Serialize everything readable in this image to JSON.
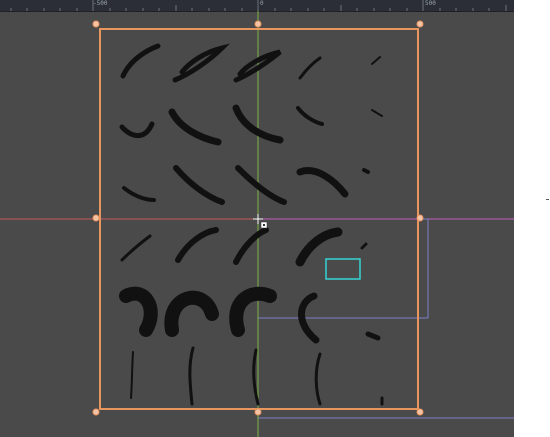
{
  "ruler": {
    "labels": [
      "-500",
      "0",
      "500"
    ]
  },
  "colors": {
    "viewport_bg": "#4a4a4a",
    "ruler_bg": "#2b2e36",
    "selection_rect": "#e8955e",
    "handle_fill": "#f5c4a8",
    "axis_x": "#c85a5a",
    "axis_y": "#7cb342",
    "guide_blue": "#7b7ec9",
    "guide_magenta": "#c060c0",
    "cyan_box": "#35d5d5",
    "sprite": "#111111"
  },
  "icons": {
    "pivot": "move-pivot-icon",
    "handle": "resize-handle-icon"
  },
  "sprite_sheet": {
    "rows": 6,
    "columns": 5
  }
}
